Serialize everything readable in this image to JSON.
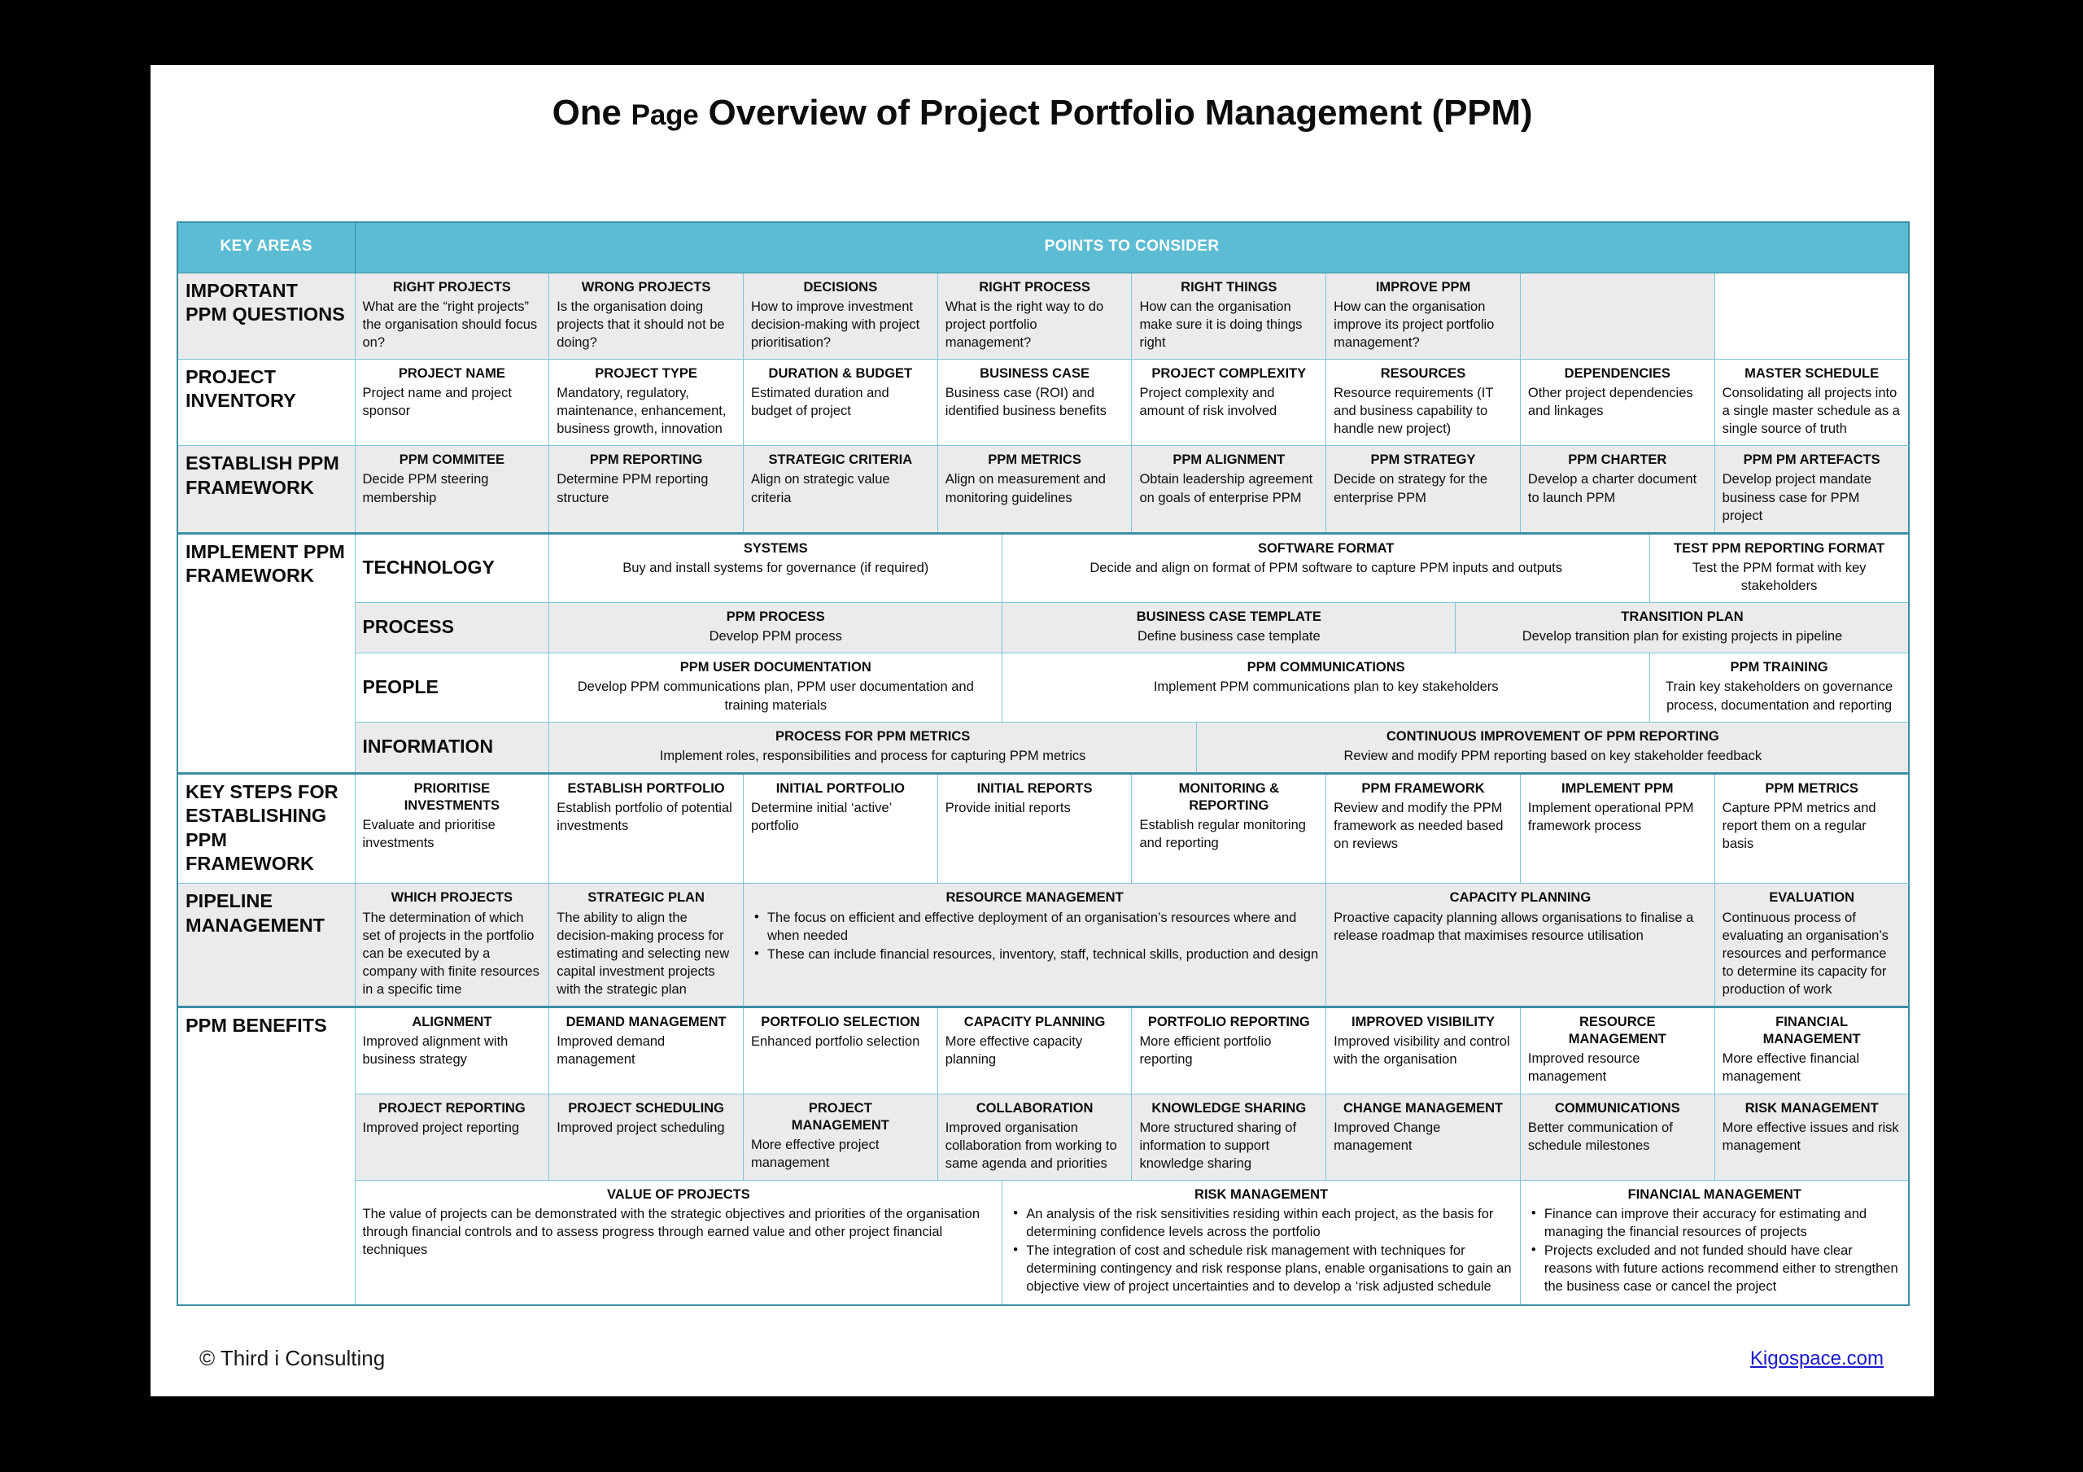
{
  "title": {
    "lead": "One ",
    "small": "Page",
    "rest": " Overview of Project Portfolio Management (PPM)"
  },
  "colors": {
    "header_blue": "#5cbcd4",
    "border_blue": "#7ec6da",
    "outer_border": "#3a8fa4",
    "row_gray": "#ebebeb",
    "link": "#1a1acd"
  },
  "table_header": {
    "key_areas": "KEY AREAS",
    "points": "POINTS TO CONSIDER"
  },
  "rows": [
    {
      "area": "IMPORTANT\nPPM  QUESTIONS",
      "shade": "gray",
      "cells": [
        {
          "h": "RIGHT PROJECTS",
          "b": "What are the “right projects” the organisation should  focus on?"
        },
        {
          "h": "WRONG PROJECTS",
          "b": "Is the organisation doing projects that it should not be doing?"
        },
        {
          "h": "DECISIONS",
          "b": "How to improve investment decision-making with project prioritisation?"
        },
        {
          "h": "RIGHT PROCESS",
          "b": "What is the right way to do project portfolio management?"
        },
        {
          "h": "RIGHT THINGS",
          "b": "How can the organisation make sure it is doing things right"
        },
        {
          "h": "IMPROVE PPM",
          "b": "How can the organisation improve its project portfolio management?"
        },
        {
          "h": "",
          "b": ""
        }
      ]
    },
    {
      "area": "PROJECT\nINVENTORY",
      "shade": "white",
      "cells": [
        {
          "h": "PROJECT NAME",
          "b": "Project name and project sponsor"
        },
        {
          "h": "PROJECT TYPE",
          "b": "Mandatory, regulatory, maintenance, enhancement, business growth, innovation"
        },
        {
          "h": "DURATION & BUDGET",
          "b": "Estimated duration and budget of project"
        },
        {
          "h": "BUSINESS CASE",
          "b": "Business case (ROI) and identified business benefits"
        },
        {
          "h": "PROJECT COMPLEXITY",
          "b": "Project complexity and amount of risk involved"
        },
        {
          "h": "RESOURCES",
          "b": "Resource requirements (IT and business capability to handle new project)"
        },
        {
          "h": "DEPENDENCIES",
          "b": "Other project dependencies and linkages"
        },
        {
          "h": "MASTER SCHEDULE",
          "b": "Consolidating all projects into a single master schedule as a single source of truth"
        }
      ]
    },
    {
      "area": "ESTABLISH PPM\nFRAMEWORK",
      "shade": "gray",
      "cells": [
        {
          "h": "PPM COMMITEE",
          "b": "Decide PPM steering membership"
        },
        {
          "h": "PPM REPORTING",
          "b": "Determine PPM reporting structure"
        },
        {
          "h": "STRATEGIC CRITERIA",
          "b": "Align on strategic value criteria"
        },
        {
          "h": "PPM METRICS",
          "b": "Align on  measurement and monitoring guidelines"
        },
        {
          "h": "PPM ALIGNMENT",
          "b": "Obtain leadership agreement on goals of enterprise PPM"
        },
        {
          "h": "PPM STRATEGY",
          "b": "Decide on strategy for the enterprise PPM"
        },
        {
          "h": "PPM CHARTER",
          "b": "Develop a charter document to launch PPM"
        },
        {
          "h": "PPM PM ARTEFACTS",
          "b": "Develop project mandate business case for PPM project"
        }
      ]
    }
  ],
  "implement": {
    "area": "IMPLEMENT PPM\nFRAMEWORK",
    "subrows": [
      {
        "label": "TECHNOLOGY",
        "shade": "white",
        "cells": [
          {
            "h": "SYSTEMS",
            "b": "Buy and install systems for governance (if required)"
          },
          {
            "h": "SOFTWARE FORMAT",
            "b": "Decide and align on format of PPM software to capture PPM inputs and outputs"
          },
          {
            "h": "TEST PPM REPORTING FORMAT",
            "b": "Test the PPM format with key stakeholders"
          }
        ]
      },
      {
        "label": "PROCESS",
        "shade": "gray",
        "cells": [
          {
            "h": "PPM PROCESS",
            "b": "Develop PPM process"
          },
          {
            "h": "BUSINESS CASE TEMPLATE",
            "b": "Define business case template"
          },
          {
            "h": "TRANSITION PLAN",
            "b": "Develop transition plan for existing projects in pipeline"
          },
          {
            "h": "",
            "b": ""
          }
        ]
      },
      {
        "label": "PEOPLE",
        "shade": "white",
        "cells": [
          {
            "h": "PPM USER DOCUMENTATION",
            "b": "Develop PPM communications plan, PPM user documentation and training materials"
          },
          {
            "h": "PPM COMMUNICATIONS",
            "b": "Implement PPM communications plan to key stakeholders"
          },
          {
            "h": "PPM TRAINING",
            "b": "Train key stakeholders on governance process, documentation and reporting"
          }
        ]
      },
      {
        "label": "INFORMATION",
        "shade": "gray",
        "cells": [
          {
            "h": "PROCESS FOR PPM METRICS",
            "b": "Implement roles, responsibilities and process for capturing PPM metrics"
          },
          {
            "h": "CONTINUOUS IMPROVEMENT OF PPM REPORTING",
            "b": "Review and modify PPM reporting based on key stakeholder feedback"
          },
          {
            "h": "",
            "b": ""
          }
        ]
      }
    ]
  },
  "key_steps": {
    "area": "KEY STEPS FOR\nESTABLISHING\nPPM FRAMEWORK",
    "shade": "white",
    "cells": [
      {
        "h": "PRIORITISE\nINVESTMENTS",
        "b": "Evaluate and prioritise investments"
      },
      {
        "h": "ESTABLISH PORTFOLIO",
        "b": "Establish portfolio of potential investments"
      },
      {
        "h": "INITIAL PORTFOLIO",
        "b": "Determine initial ‘active’ portfolio"
      },
      {
        "h": "INITIAL REPORTS",
        "b": "Provide initial reports"
      },
      {
        "h": "MONITORING &\nREPORTING",
        "b": "Establish regular monitoring and reporting"
      },
      {
        "h": "PPM FRAMEWORK",
        "b": "Review and modify the PPM framework as needed based on reviews"
      },
      {
        "h": "IMPLEMENT PPM",
        "b": "Implement operational PPM framework process"
      },
      {
        "h": "PPM METRICS",
        "b": "Capture PPM metrics and report them on a regular basis"
      }
    ]
  },
  "pipeline": {
    "area": "PIPELINE\nMANAGEMENT",
    "shade": "gray",
    "cells": [
      {
        "h": "WHICH PROJECTS",
        "b": "The determination of which set of projects in the portfolio can be executed by a company with finite resources in a specific time"
      },
      {
        "h": "STRATEGIC PLAN",
        "b": "The ability to align the decision-making process for estimating and selecting new capital investment projects with the strategic plan"
      },
      {
        "h": "RESOURCE MANAGEMENT",
        "bullets": [
          "The focus on efficient and effective deployment of an organisation’s resources where and when needed",
          "These can include financial resources, inventory, staff, technical skills, production and design"
        ]
      },
      {
        "h": "CAPACITY PLANNING",
        "b": "Proactive capacity planning allows organisations to finalise a release roadmap that maximises resource utilisation"
      },
      {
        "h": "EVALUATION",
        "b": "Continuous process of evaluating an organisation’s resources and performance to determine its capacity for production of work"
      }
    ]
  },
  "benefits": {
    "area": "PPM BENEFITS",
    "row1_shade": "white",
    "row1": [
      {
        "h": "ALIGNMENT",
        "b": "Improved alignment with business strategy"
      },
      {
        "h": "DEMAND MANAGEMENT",
        "b": "Improved demand management"
      },
      {
        "h": "PORTFOLIO SELECTION",
        "b": "Enhanced portfolio selection"
      },
      {
        "h": "CAPACITY PLANNING",
        "b": "More effective capacity planning"
      },
      {
        "h": "PORTFOLIO REPORTING",
        "b": "More efficient portfolio reporting"
      },
      {
        "h": "IMPROVED VISIBILITY",
        "b": "Improved visibility and control with the organisation"
      },
      {
        "h": "RESOURCE\nMANAGEMENT",
        "b": "Improved resource management"
      },
      {
        "h": "FINANCIAL\nMANAGEMENT",
        "b": "More effective financial management"
      }
    ],
    "row2_shade": "gray",
    "row2": [
      {
        "h": "PROJECT REPORTING",
        "b": "Improved project reporting"
      },
      {
        "h": "PROJECT SCHEDULING",
        "b": "Improved project scheduling"
      },
      {
        "h": "PROJECT\nMANAGEMENT",
        "b": "More effective project management"
      },
      {
        "h": "COLLABORATION",
        "b": "Improved organisation collaboration from working to same agenda and priorities"
      },
      {
        "h": "KNOWLEDGE SHARING",
        "b": "More structured sharing of information to support knowledge sharing"
      },
      {
        "h": "CHANGE MANAGEMENT",
        "b": "Improved Change management"
      },
      {
        "h": "COMMUNICATIONS",
        "b": "Better communication of schedule milestones"
      },
      {
        "h": "RISK MANAGEMENT",
        "b": "More effective issues and risk management"
      }
    ],
    "row3_shade": "white",
    "row3": [
      {
        "h": "VALUE OF PROJECTS",
        "b": "The value of projects can be demonstrated with the strategic objectives and priorities of the organisation through financial controls and to assess progress through earned value and other project financial techniques"
      },
      {
        "h": "RISK MANAGEMENT",
        "bullets": [
          "An analysis of the risk sensitivities residing within each project, as the basis for determining confidence levels across the portfolio",
          "The integration of cost and schedule risk management with techniques for determining contingency and risk response plans, enable organisations to gain an objective view of project uncertainties and to develop a ‘risk adjusted schedule"
        ]
      },
      {
        "h": "FINANCIAL MANAGEMENT",
        "bullets": [
          "Finance can improve their accuracy for estimating and managing the financial resources of projects",
          "Projects excluded and not funded should have clear reasons with future actions recommend either to strengthen the business case or cancel the project"
        ]
      }
    ]
  },
  "footer": {
    "copyright": "© Third i Consulting",
    "link": "Kigospace.com"
  }
}
